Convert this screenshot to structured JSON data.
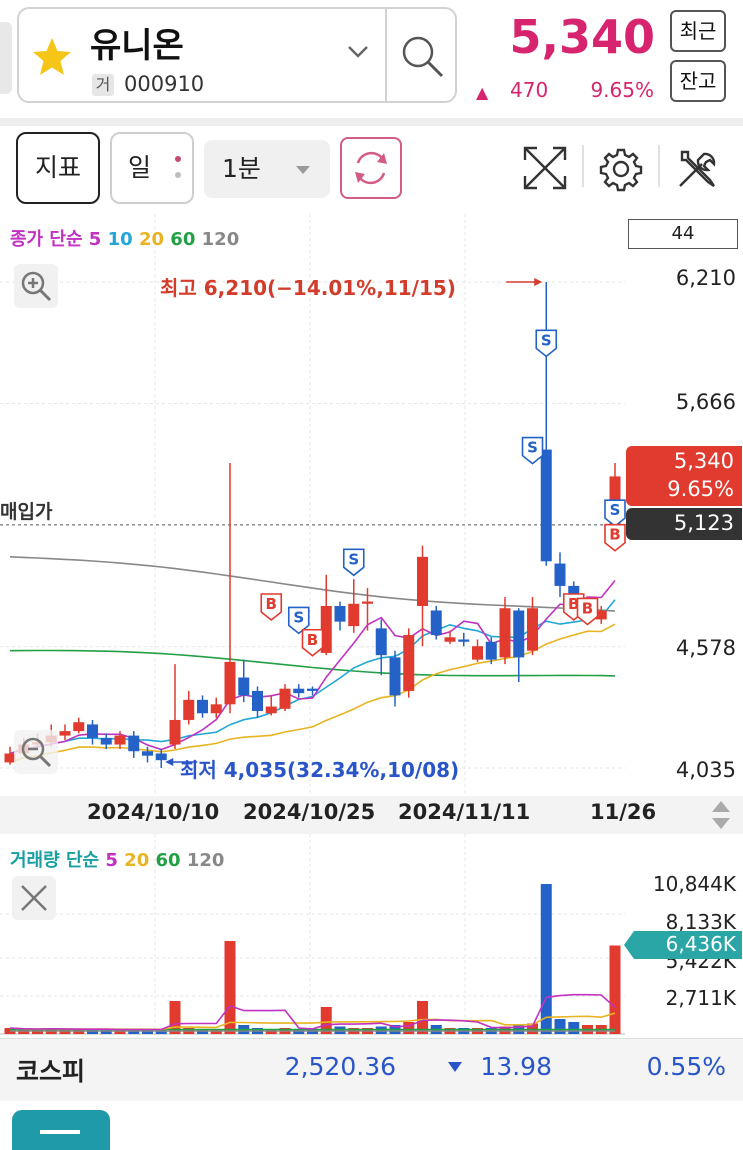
{
  "header": {
    "stock_name": "유니온",
    "exchange_badge": "거",
    "stock_code": "000910",
    "favorite_icon": "star-icon",
    "dropdown_icon": "chevron-down-icon",
    "search_icon": "search-icon",
    "price": "5,340",
    "change_arrow": "▲",
    "change": "470",
    "change_pct": "9.65%",
    "recent_button": "최근",
    "balance_button": "잔고",
    "accent_color": "#d6246e"
  },
  "toolbar": {
    "indicator_button": "지표",
    "period_button": "일",
    "interval_select": "1분",
    "refresh_icon": "refresh-icon",
    "expand_icon": "expand-icon",
    "settings_icon": "gear-icon",
    "tools_icon": "tools-icon"
  },
  "price_chart": {
    "legend_prefix": "종가 단순",
    "ma_labels": [
      "5",
      "10",
      "20",
      "60",
      "120"
    ],
    "ma_colors": [
      "#c232c2",
      "#22a6d6",
      "#e8b422",
      "#22a046",
      "#888888"
    ],
    "count_box": "44",
    "y_ticks": [
      "6,210",
      "5,666",
      "4,578",
      "4,035"
    ],
    "current_price_tag": "5,340",
    "current_pct_tag": "9.65%",
    "avg_price_tag": "5,123",
    "avg_price_label": "매입가",
    "high_annotation": "최고 6,210(−14.01%,11/15)",
    "low_annotation": "최저 4,035(32.34%,10/08)",
    "zoom_in_icon": "zoom-in-icon",
    "zoom_out_icon": "zoom-out-icon"
  },
  "x_axis": {
    "labels": [
      "2024/10/10",
      "2024/10/25",
      "2024/11/11",
      "11/26"
    ],
    "scroll_icon": "updown-arrows-icon"
  },
  "volume_chart": {
    "legend_prefix": "거래량 단순",
    "ma_labels": [
      "5",
      "20",
      "60",
      "120"
    ],
    "ma_colors": [
      "#c232c2",
      "#e8b422",
      "#22a046",
      "#888888"
    ],
    "y_ticks": [
      "10,844K",
      "8,133K",
      "5,422K",
      "2,711K"
    ],
    "current_volume_tag": "6,436K",
    "close_icon": "close-icon"
  },
  "index_bar": {
    "name": "코스피",
    "value": "2,520.36",
    "change": "13.98",
    "change_pct": "0.55%"
  },
  "chart_data": {
    "type": "candlestick",
    "y_range": [
      4035,
      6210
    ],
    "candles": [
      {
        "o": 4060,
        "c": 4100,
        "h": 4130,
        "l": 4050
      },
      {
        "o": 4100,
        "c": 4140,
        "h": 4170,
        "l": 4090
      },
      {
        "o": 4140,
        "c": 4150,
        "h": 4190,
        "l": 4120
      },
      {
        "o": 4150,
        "c": 4180,
        "h": 4230,
        "l": 4130
      },
      {
        "o": 4180,
        "c": 4200,
        "h": 4230,
        "l": 4160
      },
      {
        "o": 4200,
        "c": 4240,
        "h": 4260,
        "l": 4190
      },
      {
        "o": 4230,
        "c": 4170,
        "h": 4250,
        "l": 4140
      },
      {
        "o": 4170,
        "c": 4140,
        "h": 4190,
        "l": 4120
      },
      {
        "o": 4140,
        "c": 4180,
        "h": 4200,
        "l": 4120
      },
      {
        "o": 4180,
        "c": 4110,
        "h": 4200,
        "l": 4080
      },
      {
        "o": 4110,
        "c": 4090,
        "h": 4130,
        "l": 4060
      },
      {
        "o": 4100,
        "c": 4070,
        "h": 4120,
        "l": 4035
      },
      {
        "o": 4140,
        "c": 4250,
        "h": 4500,
        "l": 4120
      },
      {
        "o": 4250,
        "c": 4340,
        "h": 4380,
        "l": 4230
      },
      {
        "o": 4340,
        "c": 4280,
        "h": 4360,
        "l": 4260
      },
      {
        "o": 4280,
        "c": 4320,
        "h": 4350,
        "l": 4260
      },
      {
        "o": 4320,
        "c": 4510,
        "h": 5400,
        "l": 4280
      },
      {
        "o": 4440,
        "c": 4360,
        "h": 4520,
        "l": 4330
      },
      {
        "o": 4380,
        "c": 4290,
        "h": 4400,
        "l": 4260
      },
      {
        "o": 4280,
        "c": 4310,
        "h": 4360,
        "l": 4270
      },
      {
        "o": 4300,
        "c": 4390,
        "h": 4410,
        "l": 4290
      },
      {
        "o": 4390,
        "c": 4370,
        "h": 4410,
        "l": 4350
      },
      {
        "o": 4390,
        "c": 4380,
        "h": 4400,
        "l": 4360
      },
      {
        "o": 4550,
        "c": 4760,
        "h": 4900,
        "l": 4540
      },
      {
        "o": 4760,
        "c": 4690,
        "h": 4780,
        "l": 4650
      },
      {
        "o": 4670,
        "c": 4770,
        "h": 4880,
        "l": 4640
      },
      {
        "o": 4770,
        "c": 4780,
        "h": 4840,
        "l": 4650
      },
      {
        "o": 4660,
        "c": 4540,
        "h": 4700,
        "l": 4450
      },
      {
        "o": 4530,
        "c": 4360,
        "h": 4560,
        "l": 4310
      },
      {
        "o": 4380,
        "c": 4630,
        "h": 4660,
        "l": 4350
      },
      {
        "o": 4760,
        "c": 4980,
        "h": 5030,
        "l": 4580
      },
      {
        "o": 4740,
        "c": 4630,
        "h": 4760,
        "l": 4610
      },
      {
        "o": 4600,
        "c": 4620,
        "h": 4650,
        "l": 4590
      },
      {
        "o": 4610,
        "c": 4600,
        "h": 4640,
        "l": 4580
      },
      {
        "o": 4520,
        "c": 4580,
        "h": 4610,
        "l": 4510
      },
      {
        "o": 4600,
        "c": 4520,
        "h": 4620,
        "l": 4500
      },
      {
        "o": 4530,
        "c": 4750,
        "h": 4800,
        "l": 4500
      },
      {
        "o": 4740,
        "c": 4530,
        "h": 4750,
        "l": 4420
      },
      {
        "o": 4560,
        "c": 4750,
        "h": 4800,
        "l": 4540
      },
      {
        "o": 5460,
        "c": 4960,
        "h": 6210,
        "l": 4940
      },
      {
        "o": 4950,
        "c": 4850,
        "h": 5000,
        "l": 4800
      },
      {
        "o": 4850,
        "c": 4720,
        "h": 4870,
        "l": 4700
      },
      {
        "o": 4720,
        "c": 4720,
        "h": 4760,
        "l": 4700
      },
      {
        "o": 4700,
        "c": 4740,
        "h": 4760,
        "l": 4680
      },
      {
        "o": 5050,
        "c": 5340,
        "h": 5400,
        "l": 5030
      }
    ],
    "volumes": [
      0.04,
      0.03,
      0.03,
      0.04,
      0.03,
      0.03,
      0.03,
      0.03,
      0.03,
      0.03,
      0.03,
      0.03,
      0.22,
      0.04,
      0.03,
      0.03,
      0.62,
      0.06,
      0.04,
      0.03,
      0.04,
      0.03,
      0.03,
      0.18,
      0.05,
      0.04,
      0.04,
      0.05,
      0.06,
      0.08,
      0.22,
      0.06,
      0.04,
      0.04,
      0.04,
      0.04,
      0.05,
      0.06,
      0.07,
      1.0,
      0.1,
      0.08,
      0.06,
      0.06,
      0.59
    ]
  }
}
